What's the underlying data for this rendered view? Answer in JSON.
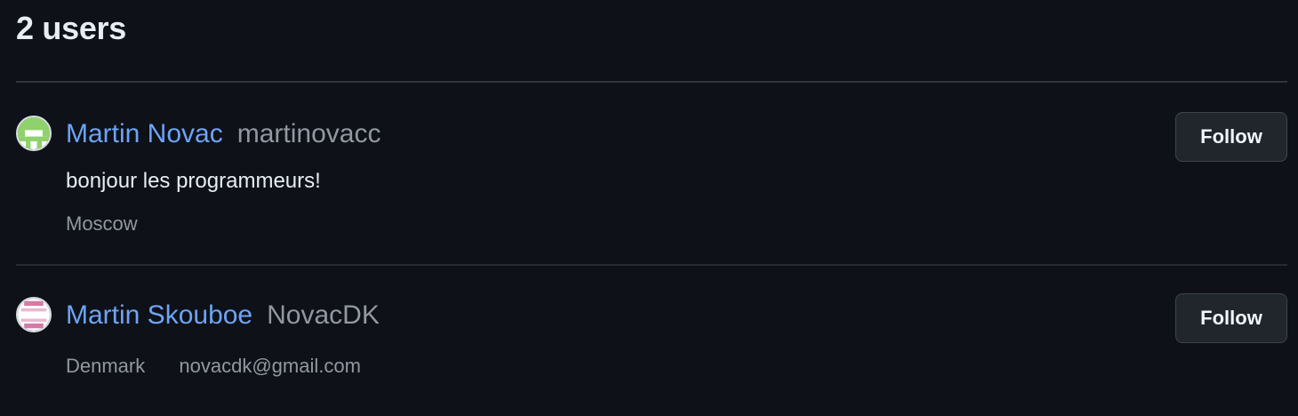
{
  "results": {
    "title": "2 users"
  },
  "users": [
    {
      "display_name": "Martin Novac",
      "login": "martinovacc",
      "bio": "bonjour les programmeurs!",
      "location": "Moscow",
      "follow_label": "Follow",
      "avatar_colors": {
        "bg": "#ffffff",
        "fg": "#8fd16b"
      }
    },
    {
      "display_name": "Martin Skouboe",
      "login": "NovacDK",
      "location": "Denmark",
      "email": "novacdk@gmail.com",
      "follow_label": "Follow",
      "avatar_colors": {
        "bg": "#ffffff",
        "fg": "#d47aa6"
      }
    }
  ],
  "theme": {
    "background": "#0e1117",
    "link": "#6ca4f8",
    "muted": "#9198a1",
    "border": "#30363d"
  }
}
